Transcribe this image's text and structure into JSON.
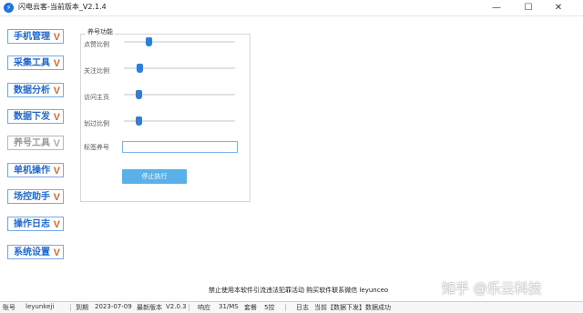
{
  "window": {
    "title": "闪电云客-当前版本_V2.1.4",
    "min": "—",
    "max": "☐",
    "close": "✕"
  },
  "sidebar": {
    "chevron": "V",
    "items": [
      {
        "label": "手机管理",
        "enabled": true
      },
      {
        "label": "采集工具",
        "enabled": true
      },
      {
        "label": "数据分析",
        "enabled": true
      },
      {
        "label": "数据下发",
        "enabled": true
      },
      {
        "label": "养号工具",
        "enabled": false
      },
      {
        "label": "单机操作",
        "enabled": true
      },
      {
        "label": "场控助手",
        "enabled": true
      },
      {
        "label": "操作日志",
        "enabled": true
      },
      {
        "label": "系统设置",
        "enabled": true
      }
    ]
  },
  "panel": {
    "title": "养号功能",
    "sliders": [
      {
        "label": "点赞比例",
        "level": 0.22
      },
      {
        "label": "关注比例",
        "level": 0.14
      },
      {
        "label": "访问主页",
        "level": 0.13
      },
      {
        "label": "划过比例",
        "level": 0.13
      }
    ],
    "tag_label": "标签养号",
    "tag_value": "",
    "stop_button": "停止执行"
  },
  "notice": "禁止使用本软件引流违法犯罪活动 购买软件联系微信 leyunceo",
  "status": {
    "account_label": "账号",
    "account": "leyunkeji",
    "expire_label": "到期",
    "expire": "2023-07-09",
    "version_label": "最新版本",
    "version": "V2.0.3",
    "latency_label": "响应",
    "latency": "31/MS",
    "slots_label": "套餐",
    "slots": "5控",
    "log_label": "日志",
    "log": "当前【数据下发】数据成功"
  },
  "watermark": "知乎 @乐云科技",
  "colors": {
    "accent": "#1e67d2",
    "chevron": "#e0662a",
    "button": "#5ab1ea",
    "slider": "#2f7fd8"
  }
}
